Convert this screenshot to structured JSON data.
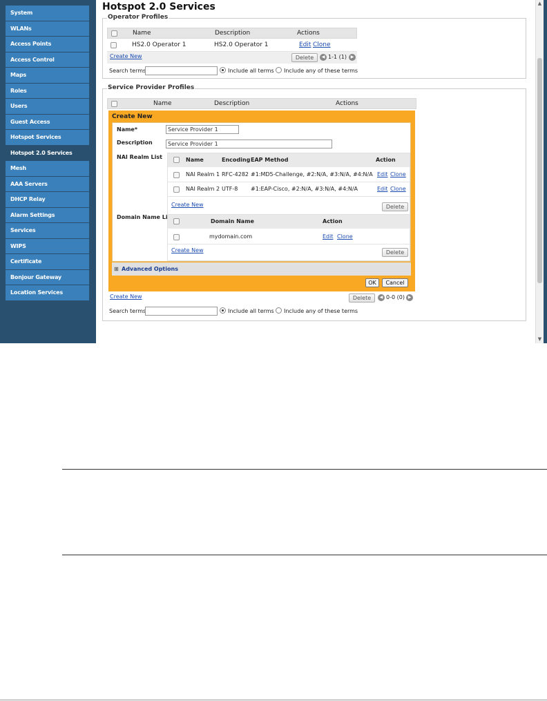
{
  "sidebar": {
    "items": [
      {
        "label": "System"
      },
      {
        "label": "WLANs"
      },
      {
        "label": "Access Points"
      },
      {
        "label": "Access Control"
      },
      {
        "label": "Maps"
      },
      {
        "label": "Roles"
      },
      {
        "label": "Users"
      },
      {
        "label": "Guest Access"
      },
      {
        "label": "Hotspot Services"
      },
      {
        "label": "Hotspot 2.0 Services",
        "active": true
      },
      {
        "label": "Mesh"
      },
      {
        "label": "AAA Servers"
      },
      {
        "label": "DHCP Relay"
      },
      {
        "label": "Alarm Settings"
      },
      {
        "label": "Services"
      },
      {
        "label": "WIPS"
      },
      {
        "label": "Certificate"
      },
      {
        "label": "Bonjour Gateway"
      },
      {
        "label": "Location Services"
      }
    ]
  },
  "page": {
    "title": "Hotspot 2.0 Services"
  },
  "operator_profiles": {
    "legend": "Operator Profiles",
    "columns": {
      "name": "Name",
      "description": "Description",
      "actions": "Actions"
    },
    "rows": [
      {
        "name": "HS2.0 Operator 1",
        "description": "HS2.0 Operator 1",
        "edit": "Edit",
        "clone": "Clone"
      }
    ],
    "create_new": "Create New",
    "delete": "Delete",
    "pager": "1-1 (1)",
    "search_label": "Search terms",
    "search_value": "",
    "radio_all": "Include all terms",
    "radio_any": "Include any of these terms"
  },
  "service_provider_profiles": {
    "legend": "Service Provider Profiles",
    "columns": {
      "name": "Name",
      "description": "Description",
      "actions": "Actions"
    },
    "create_panel": {
      "title": "Create New",
      "name_label": "Name*",
      "name_value": "Service Provider 1",
      "description_label": "Description",
      "description_value": "Service Provider 1",
      "nai_label": "NAI Realm List",
      "nai_columns": {
        "name": "Name",
        "encoding": "Encoding",
        "eap": "EAP Method",
        "action": "Action"
      },
      "nai_rows": [
        {
          "name": "NAI Realm 1",
          "encoding": "RFC-4282",
          "eap": "#1:MD5-Challenge, #2:N/A, #3:N/A, #4:N/A",
          "edit": "Edit",
          "clone": "Clone"
        },
        {
          "name": "NAI Realm 2",
          "encoding": "UTF-8",
          "eap": "#1:EAP-Cisco, #2:N/A, #3:N/A, #4:N/A",
          "edit": "Edit",
          "clone": "Clone"
        }
      ],
      "nai_create_new": "Create New",
      "nai_delete": "Delete",
      "domain_label": "Domain Name List",
      "domain_columns": {
        "name": "Domain Name",
        "action": "Action"
      },
      "domain_rows": [
        {
          "name": "mydomain.com",
          "edit": "Edit",
          "clone": "Clone"
        }
      ],
      "domain_create_new": "Create New",
      "domain_delete": "Delete",
      "advanced": "Advanced Options",
      "ok": "OK",
      "cancel": "Cancel"
    },
    "create_new": "Create New",
    "delete": "Delete",
    "pager": "0-0 (0)",
    "search_label": "Search terms",
    "search_value": "",
    "radio_all": "Include all terms",
    "radio_any": "Include any of these terms"
  }
}
